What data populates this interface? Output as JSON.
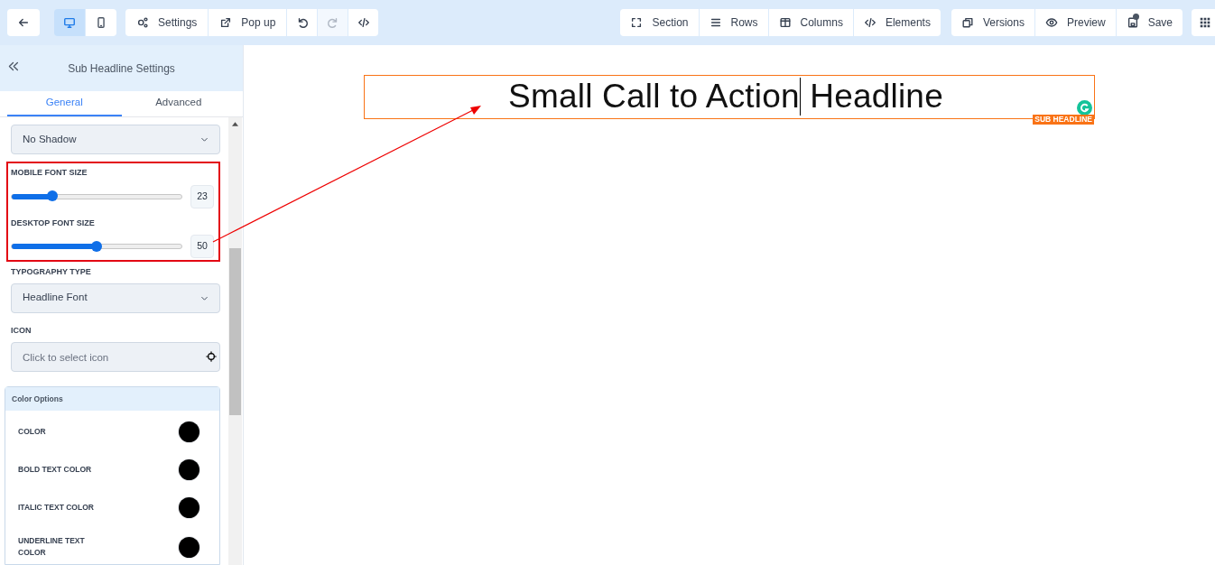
{
  "toolbar": {
    "devices": [
      {
        "selected": true
      },
      {
        "selected": false
      }
    ],
    "left_group": [
      {
        "label": "Settings",
        "disabled": false
      },
      {
        "label": "Pop up",
        "disabled": false
      },
      {
        "disabled": false
      },
      {
        "disabled": true
      },
      {
        "disabled": false
      }
    ],
    "structure_group": [
      {
        "label": "Section"
      },
      {
        "label": "Rows"
      },
      {
        "label": "Columns"
      },
      {
        "label": "Elements"
      }
    ],
    "history_group": [
      {
        "label": "Versions"
      },
      {
        "label": "Preview"
      },
      {
        "label": "Save"
      }
    ]
  },
  "sidebar": {
    "title": "Sub Headline Settings",
    "tabs": [
      {
        "label": "General",
        "selected": true
      },
      {
        "label": "Advanced",
        "selected": false
      }
    ],
    "shadow_select": {
      "value": "No Shadow"
    },
    "sliders": [
      {
        "label": "MOBILE FONT SIZE",
        "level": 0.24,
        "value": "23"
      },
      {
        "label": "DESKTOP FONT SIZE",
        "level": 0.5,
        "value": "50"
      }
    ],
    "typography": {
      "label": "TYPOGRAPHY TYPE",
      "value": "Headline Font"
    },
    "icon_field": {
      "label": "ICON",
      "placeholder": "Click to select icon"
    },
    "color_options": {
      "title": "Color Options",
      "items": [
        {
          "label": "COLOR",
          "color": "#000000"
        },
        {
          "label": "BOLD TEXT COLOR",
          "color": "#000000"
        },
        {
          "label": "ITALIC TEXT COLOR",
          "color": "#000000"
        },
        {
          "label": "UNDERLINE TEXT COLOR",
          "color": "#000000"
        }
      ]
    }
  },
  "canvas": {
    "headline": {
      "before_cursor": "Small Call to Action",
      "after_cursor": " Headline",
      "tag": "SUB HEADLINE"
    }
  }
}
